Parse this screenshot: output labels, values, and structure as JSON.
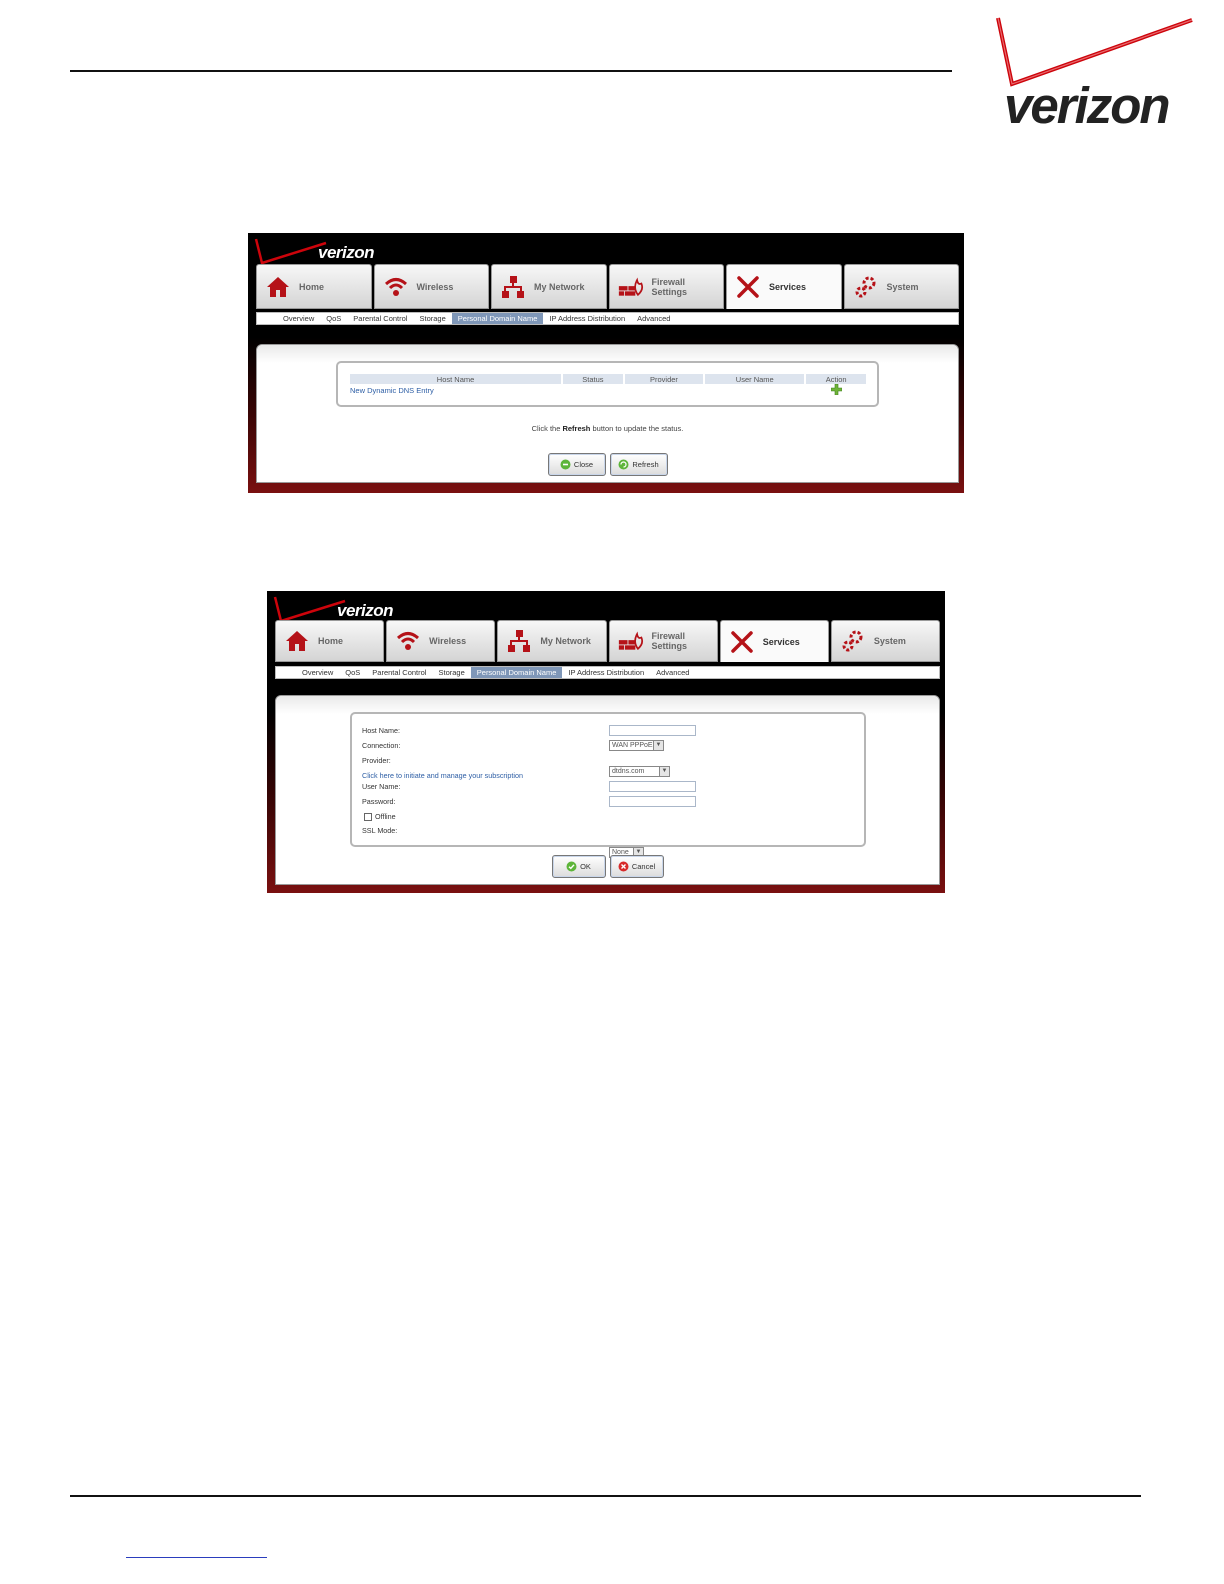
{
  "logo": {
    "text": "verizon"
  },
  "shot1": {
    "brand": "verizon",
    "tabs": [
      "Home",
      "Wireless",
      "My Network",
      "Firewall Settings",
      "Services",
      "System"
    ],
    "active_tab": "Services",
    "subnav": [
      "Overview",
      "QoS",
      "Parental Control",
      "Storage",
      "Personal Domain Name",
      "IP Address Distribution",
      "Advanced"
    ],
    "active_subnav": "Personal Domain Name",
    "table": {
      "headers": [
        "Host Name",
        "Status",
        "Provider",
        "User Name",
        "Action"
      ],
      "new_entry_link": "New Dynamic DNS Entry"
    },
    "hint_before": "Click the ",
    "hint_bold": "Refresh",
    "hint_after": " button to update the status.",
    "buttons": {
      "close": "Close",
      "refresh": "Refresh"
    }
  },
  "shot2": {
    "brand": "verizon",
    "tabs": [
      "Home",
      "Wireless",
      "My Network",
      "Firewall Settings",
      "Services",
      "System"
    ],
    "active_tab": "Services",
    "subnav": [
      "Overview",
      "QoS",
      "Parental Control",
      "Storage",
      "Personal Domain Name",
      "IP Address Distribution",
      "Advanced"
    ],
    "active_subnav": "Personal Domain Name",
    "form": {
      "host_name_label": "Host Name:",
      "host_name_value": "",
      "connection_label": "Connection:",
      "connection_value": "WAN PPPoE",
      "provider_label": "Provider:",
      "provider_value": "dtdns.com",
      "subscription_link": "Click here to initiate and manage your subscription",
      "user_name_label": "User Name:",
      "user_name_value": "",
      "password_label": "Password:",
      "password_value": "",
      "offline_label": "Offline",
      "ssl_mode_label": "SSL Mode:",
      "ssl_mode_value": "None"
    },
    "buttons": {
      "ok": "OK",
      "cancel": "Cancel"
    }
  },
  "colors": {
    "brand_red": "#cd040b",
    "tab_icon_red": "#b51218",
    "link_blue": "#2d5ea5",
    "active_subnav": "#7f97b8"
  }
}
